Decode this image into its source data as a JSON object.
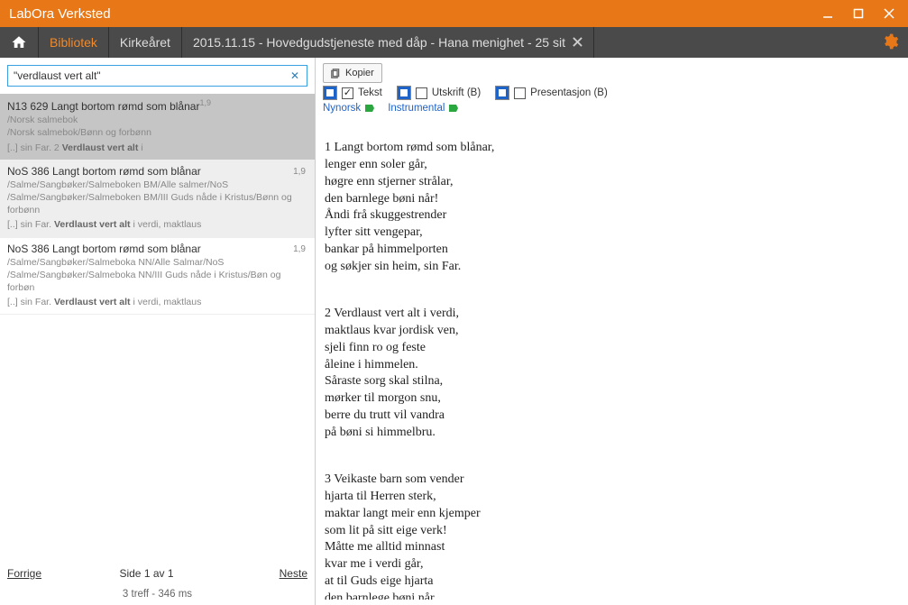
{
  "app": {
    "title": "LabOra Verksted"
  },
  "nav": {
    "bibliotek": "Bibliotek",
    "kirkeaaret": "Kirkeåret",
    "workspace": "2015.11.15 - Hovedgudstjeneste med dåp - Hana menighet - 25 sit"
  },
  "search": {
    "value": "\"verdlaust vert alt\""
  },
  "results": [
    {
      "selected": true,
      "title": "N13 629  Langt bortom rømd som blånar",
      "sup": "1,9",
      "tag": "",
      "paths": [
        "/Norsk salmebok",
        "/Norsk salmebok/Bønn og forbønn"
      ],
      "snippet_pre": "[..] sin Far.  2 ",
      "snippet_hit": "Verdlaust vert alt",
      "snippet_post": " i"
    },
    {
      "selected": false,
      "hl": true,
      "title": "NoS 386 Langt bortom rømd som blånar",
      "tag": "1,9",
      "paths": [
        "/Salme/Sangbøker/Salmeboken BM/Alle salmer/NoS",
        "/Salme/Sangbøker/Salmeboken BM/III Guds nåde i Kristus/Bønn og forbønn"
      ],
      "snippet_pre": "[..] sin Far.  ",
      "snippet_hit": "Verdlaust vert alt",
      "snippet_post": " i verdi, maktlaus"
    },
    {
      "selected": false,
      "title": "NoS 386 Langt bortom rømd som blånar",
      "tag": "1,9",
      "paths": [
        "/Salme/Sangbøker/Salmeboka NN/Alle Salmar/NoS",
        "/Salme/Sangbøker/Salmeboka NN/III Guds nåde i Kristus/Bøn og forbøn"
      ],
      "snippet_pre": "[..] sin Far.  ",
      "snippet_hit": "Verdlaust vert alt",
      "snippet_post": " i verdi, maktlaus"
    }
  ],
  "pager": {
    "prev": "Forrige",
    "page": "Side 1 av 1",
    "next": "Neste",
    "stats": "3 treff - 346 ms"
  },
  "toolbar": {
    "copy": "Kopier",
    "tekst": "Tekst",
    "utskrift": "Utskrift (B)",
    "presentasjon": "Presentasjon (B)",
    "nynorsk": "Nynorsk",
    "instrumental": "Instrumental"
  },
  "hymn": {
    "v1": "1 Langt bortom rømd som blånar,\nlenger enn soler går,\nhøgre enn stjerner strålar,\nden barnlege bøni når!\nÅndi frå skuggestrender\nlyfter sitt vengepar,\nbankar på himmelporten\nog søkjer sin heim, sin Far.",
    "v2": "2 Verdlaust vert alt i verdi,\nmaktlaus kvar jordisk ven,\nsjeli finn ro og feste\nåleine i himmelen.\nSåraste sorg skal stilna,\nmørker til morgon snu,\nberre du trutt vil vandra\npå bøni si himmelbru.",
    "v3": "3 Veikaste barn som vender\nhjarta til Herren sterk,\nmaktar langt meir enn kjemper\nsom lit på sitt eige verk!\nMåtte me alltid minnast\nkvar me i verdi går,\nat til Guds eige hjarta\nden barnlege bøni når."
  }
}
